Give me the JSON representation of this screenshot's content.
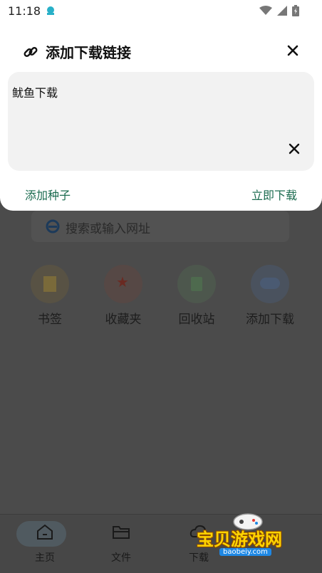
{
  "status_bar": {
    "time": "11:18"
  },
  "dialog": {
    "title": "添加下载链接",
    "input_value": "鱿鱼下载",
    "action_left": "添加种子",
    "action_right": "立即下载"
  },
  "search": {
    "placeholder": "搜索或输入网址"
  },
  "shortcuts": [
    {
      "label": "书签",
      "icon": "bookmark-icon",
      "color": "#7a6a3a"
    },
    {
      "label": "收藏夹",
      "icon": "star-icon",
      "color": "#6a4a42"
    },
    {
      "label": "回收站",
      "icon": "trash-icon",
      "color": "#4e6a4e"
    },
    {
      "label": "添加下载",
      "icon": "cloud-upload-icon",
      "color": "#4a5a72"
    }
  ],
  "bottom_nav": [
    {
      "label": "主页",
      "icon": "home-icon"
    },
    {
      "label": "文件",
      "icon": "folder-icon"
    },
    {
      "label": "下载",
      "icon": "download-cloud-icon"
    },
    {
      "label": "",
      "icon": ""
    }
  ],
  "watermark": {
    "text": "宝贝游戏网",
    "url": "baobeiy.com"
  }
}
